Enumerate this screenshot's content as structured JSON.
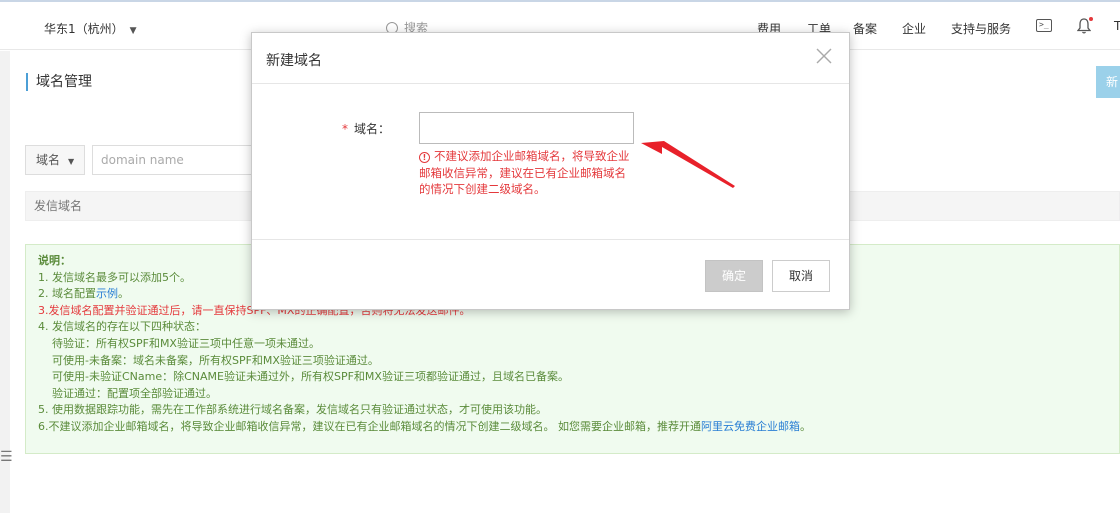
{
  "header": {
    "region": "华东1（杭州）",
    "search_placeholder": "搜索",
    "nav": [
      "费用",
      "工单",
      "备案",
      "企业",
      "支持与服务"
    ],
    "edge_text": "T"
  },
  "page": {
    "title": "域名管理",
    "new_button": "新",
    "filter_select": "域名",
    "filter_placeholder": "domain name",
    "table_header": "发信域名"
  },
  "notes": {
    "title": "说明：",
    "line1": "1. 发信域名最多可以添加5个。",
    "line2_prefix": "2. 域名配置",
    "line2_link": "示例",
    "line2_suffix": "。",
    "line3": "3.发信域名配置并验证通过后，请一直保持SPF、MX的正确配置，否则将无法发送邮件。",
    "line4": "4. 发信域名的存在以下四种状态：",
    "line4a": "待验证：所有权SPF和MX验证三项中任意一项未通过。",
    "line4b": "可使用-未备案：域名未备案，所有权SPF和MX验证三项验证通过。",
    "line4c": "可使用-未验证CName：除CNAME验证未通过外，所有权SPF和MX验证三项都验证通过，且域名已备案。",
    "line4d": "验证通过：配置项全部验证通过。",
    "line5": "5. 使用数据跟踪功能，需先在工作部系统进行域名备案，发信域名只有验证通过状态，才可使用该功能。",
    "line6_prefix": "6.不建议添加企业邮箱域名，将导致企业邮箱收信异常，建议在已有企业邮箱域名的情况下创建二级域名。 如您需要企业邮箱，推荐开通",
    "line6_link": "阿里云免费企业邮箱",
    "line6_suffix": "。"
  },
  "modal": {
    "title": "新建域名",
    "required_mark": "*",
    "field_label": "域名：",
    "field_value": "",
    "warning": "不建议添加企业邮箱域名，将导致企业邮箱收信异常，建议在已有企业邮箱域名的情况下创建二级域名。",
    "ok_label": "确定",
    "cancel_label": "取消"
  },
  "colors": {
    "accent": "#4c9fd6",
    "warning_red": "#e4393c",
    "notes_green": "#5a8b3a",
    "arrow_red": "#e8212a"
  }
}
